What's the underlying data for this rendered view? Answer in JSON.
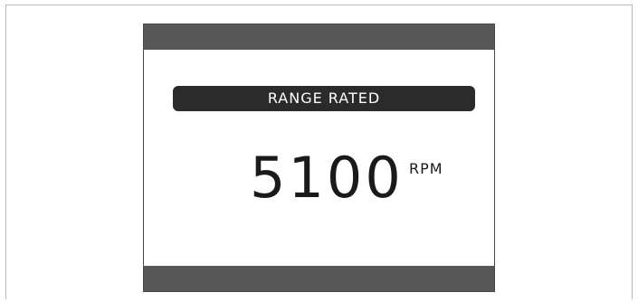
{
  "display": {
    "mode_label": "RANGE RATED",
    "value": "5100",
    "unit": "RPM"
  },
  "colors": {
    "bar": "#575757",
    "banner": "#2b2b2b",
    "banner_text": "#ffffff",
    "readout_text": "#1a1a1a"
  }
}
